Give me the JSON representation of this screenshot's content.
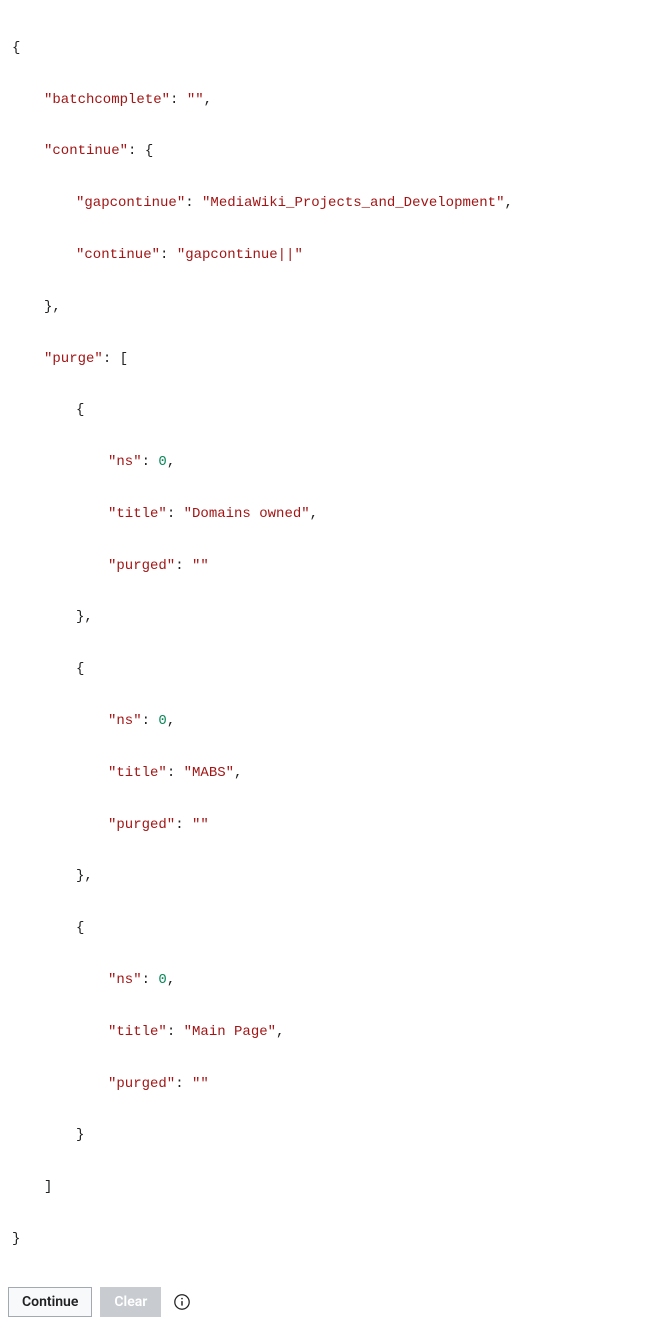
{
  "json": {
    "batchcomplete_key": "\"batchcomplete\"",
    "batchcomplete_val": "\"\"",
    "continue_key": "\"continue\"",
    "continue_obj": {
      "gapcontinue_key": "\"gapcontinue\"",
      "gapcontinue_val": "\"MediaWiki_Projects_and_Development\"",
      "continue_key": "\"continue\"",
      "continue_val": "\"gapcontinue||\""
    },
    "purge_key": "\"purge\"",
    "purge": [
      {
        "ns_key": "\"ns\"",
        "ns_val": "0",
        "title_key": "\"title\"",
        "title_val": "\"Domains owned\"",
        "purged_key": "\"purged\"",
        "purged_val": "\"\""
      },
      {
        "ns_key": "\"ns\"",
        "ns_val": "0",
        "title_key": "\"title\"",
        "title_val": "\"MABS\"",
        "purged_key": "\"purged\"",
        "purged_val": "\"\""
      },
      {
        "ns_key": "\"ns\"",
        "ns_val": "0",
        "title_key": "\"title\"",
        "title_val": "\"Main Page\"",
        "purged_key": "\"purged\"",
        "purged_val": "\"\""
      }
    ]
  },
  "buttons": {
    "continue": "Continue",
    "clear": "Clear"
  }
}
